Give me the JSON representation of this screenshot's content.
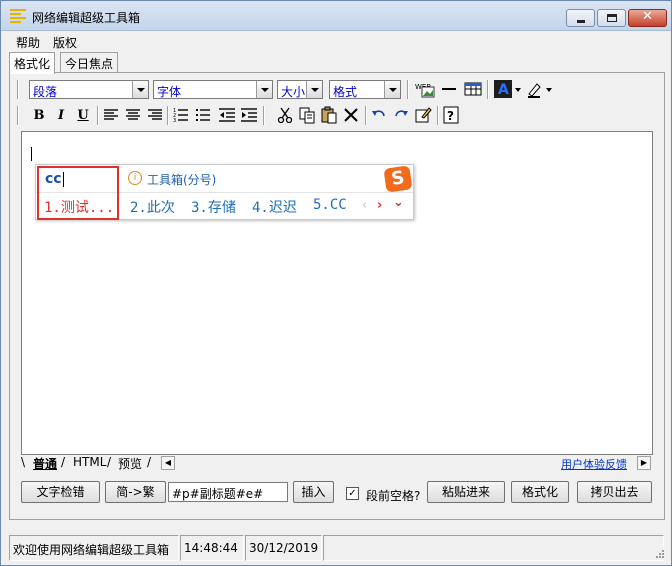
{
  "window": {
    "title": "网络编辑超级工具箱",
    "minimize_label": "",
    "maximize_label": "",
    "close_glyph": "✕"
  },
  "menu": {
    "items": [
      {
        "label": "帮助"
      },
      {
        "label": "版权"
      }
    ]
  },
  "tabs": [
    {
      "label": "格式化",
      "active": true
    },
    {
      "label": "今日焦点",
      "active": false
    }
  ],
  "toolbar": {
    "paragraph_combo": "段落",
    "font_combo": "字体",
    "size_combo": "大小",
    "format_combo": "格式",
    "icons": [
      "web-image-icon",
      "horizontal-rule-icon",
      "table-icon",
      "font-color-icon",
      "highlight-color-icon"
    ],
    "format_buttons": {
      "bold": "B",
      "italic": "I",
      "underline": "U"
    },
    "buttons2": [
      "align-left-icon",
      "align-center-icon",
      "align-right-icon",
      "ordered-list-icon",
      "unordered-list-icon",
      "outdent-icon",
      "indent-icon",
      "cut-icon",
      "copy-icon",
      "paste-icon",
      "delete-icon",
      "undo-icon",
      "redo-icon",
      "edit-icon",
      "help-icon"
    ]
  },
  "ime": {
    "input": "cc",
    "hint": "工具箱(分号)",
    "logo": "S",
    "candidates": [
      {
        "label": "1.测试..."
      },
      {
        "label": "2.此次"
      },
      {
        "label": "3.存储"
      },
      {
        "label": "4.迟迟"
      },
      {
        "label": "5.CC"
      }
    ],
    "nav_prev": "‹",
    "nav_next": "›",
    "nav_more": "⌄"
  },
  "view_tabs": [
    {
      "label": "普通",
      "active": true
    },
    {
      "label": "HTML",
      "active": false
    },
    {
      "label": "预览",
      "active": false
    }
  ],
  "feedback_link": "用户体验反馈",
  "actions": {
    "spellcheck": "文字检错",
    "convert": "简->繁",
    "tag_input": "#p#副标题#e#",
    "insert": "插入",
    "indent_checkbox_label": "段前空格?",
    "indent_checked": true,
    "paste_in": "粘贴进来",
    "format": "格式化",
    "copy_out": "拷贝出去"
  },
  "status": {
    "message": "欢迎使用网络编辑超级工具箱",
    "time": "14:48:44",
    "date": "30/12/2019"
  },
  "colors": {
    "title_bg": "#c3d4ea",
    "ime_highlight": "#e0302b",
    "candidate": "#1f6fb5",
    "link": "#0033cc",
    "sogou": "#f26b1d"
  }
}
